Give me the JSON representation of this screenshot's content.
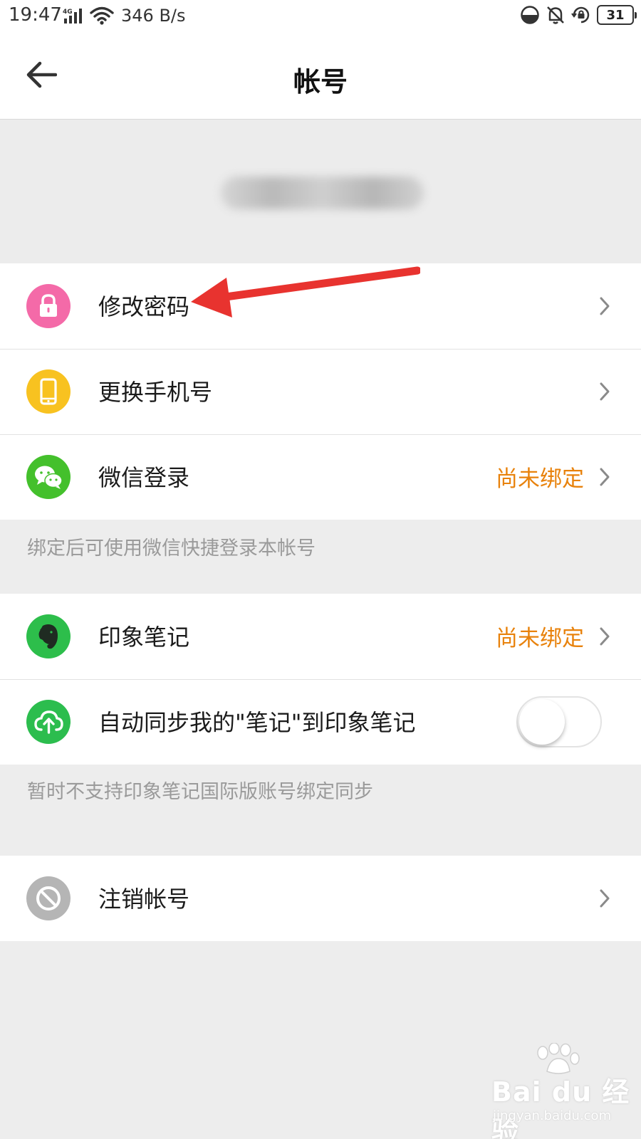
{
  "status_bar": {
    "time": "19:47",
    "network_label": "4G",
    "speed": "346 B/s",
    "battery": "31"
  },
  "nav": {
    "title": "帐号"
  },
  "group1": {
    "items": [
      {
        "label": "修改密码",
        "icon": "lock-icon",
        "color": "#f46aa8"
      },
      {
        "label": "更换手机号",
        "icon": "phone-icon",
        "color": "#f8c220"
      },
      {
        "label": "微信登录",
        "icon": "wechat-icon",
        "color": "#44c02c",
        "status": "尚未绑定"
      }
    ],
    "hint": "绑定后可使用微信快捷登录本帐号"
  },
  "group2": {
    "items": [
      {
        "label": "印象笔记",
        "icon": "evernote-icon",
        "color": "#2dbe4b",
        "status": "尚未绑定"
      },
      {
        "label": "自动同步我的\"笔记\"到印象笔记",
        "icon": "cloud-upload-icon",
        "color": "#2cbd4e",
        "toggle_on": false
      }
    ],
    "hint": "暂时不支持印象笔记国际版账号绑定同步"
  },
  "group3": {
    "items": [
      {
        "label": "注销帐号",
        "icon": "prohibited-icon",
        "color": "#b5b5b5"
      }
    ]
  },
  "colors": {
    "status_orange": "#e8820c",
    "annotation_red": "#e8332f"
  },
  "watermark": {
    "brand": "Bai du 经验",
    "url": "jingyan.baidu.com"
  }
}
